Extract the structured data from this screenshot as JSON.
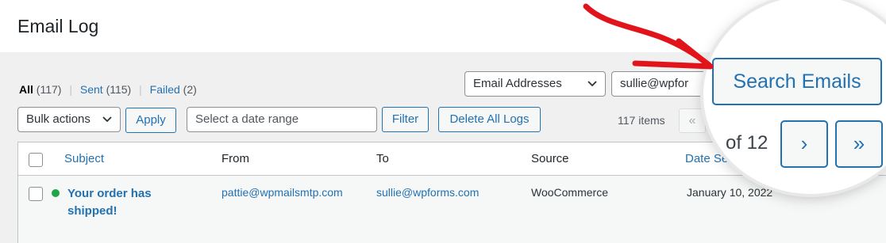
{
  "page": {
    "title": "Email Log"
  },
  "filters": {
    "all_label": "All",
    "all_count": "(117)",
    "sent_label": "Sent",
    "sent_count": "(115)",
    "failed_label": "Failed",
    "failed_count": "(2)",
    "separator": "|"
  },
  "search": {
    "field_select": "Email Addresses",
    "query_value": "sullie@wpfor",
    "button_label": "Search Emails"
  },
  "toolbar": {
    "bulk_actions": "Bulk actions",
    "apply_label": "Apply",
    "date_placeholder": "Select a date range",
    "filter_label": "Filter",
    "delete_all_label": "Delete All Logs",
    "items_count": "117 items"
  },
  "pagination": {
    "first_symbol": "«",
    "of_pages": "of 12",
    "next_symbol": "›",
    "last_symbol": "»"
  },
  "table": {
    "headers": {
      "subject": "Subject",
      "from": "From",
      "to": "To",
      "source": "Source",
      "date": "Date Se"
    },
    "rows": [
      {
        "subject": "Your order has shipped!",
        "from": "pattie@wpmailsmtp.com",
        "to": "sullie@wpforms.com",
        "source": "WooCommerce",
        "date": "January 10, 2022"
      }
    ]
  },
  "colors": {
    "accent": "#2271b1",
    "status_sent": "#1fa648",
    "arrow": "#e2141b"
  },
  "icons": [
    "chevron-down-icon",
    "status-dot-icon",
    "hand-drawn-arrow-icon"
  ]
}
